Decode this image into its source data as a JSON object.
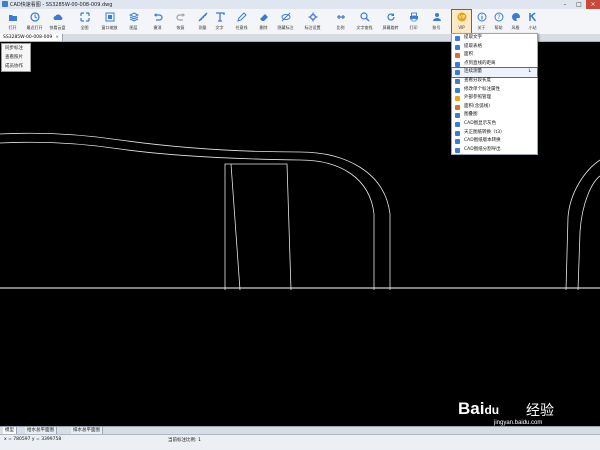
{
  "window": {
    "title": "CAD快速看图 - SS3285W-00-008-009.dwg"
  },
  "toolbar": {
    "items": [
      {
        "label": "打开",
        "icon": "folder-icon",
        "color": "#3a7bd5"
      },
      {
        "label": "最近打开",
        "icon": "clock-icon",
        "color": "#3a7bd5"
      },
      {
        "label": "快看云盘",
        "icon": "cloud-icon",
        "color": "#3a7bd5"
      },
      {
        "label": "全图",
        "icon": "expand-icon",
        "color": "#3a7bd5"
      },
      {
        "label": "窗口缩放",
        "icon": "window-zoom-icon",
        "color": "#3a7bd5"
      },
      {
        "label": "图层",
        "icon": "layers-icon",
        "color": "#3a7bd5"
      },
      {
        "label": "撤消",
        "icon": "undo-icon",
        "color": "#3a7bd5"
      },
      {
        "label": "恢复",
        "icon": "redo-icon",
        "color": "#9aa4b2"
      },
      {
        "label": "测量",
        "icon": "measure-icon",
        "color": "#3a7bd5"
      },
      {
        "label": "文字",
        "icon": "text-icon",
        "color": "#3a7bd5"
      },
      {
        "label": "任意线",
        "icon": "pen-icon",
        "color": "#3a7bd5"
      },
      {
        "label": "删除",
        "icon": "eraser-icon",
        "color": "#3a7bd5"
      },
      {
        "label": "隐藏标注",
        "icon": "eye-off-icon",
        "color": "#3a7bd5"
      },
      {
        "label": "标注设置",
        "icon": "settings-icon",
        "color": "#3a7bd5"
      },
      {
        "label": "比例",
        "icon": "scale-icon",
        "color": "#3a7bd5"
      },
      {
        "label": "文字查找",
        "icon": "search-icon",
        "color": "#3a7bd5"
      },
      {
        "label": "屏幕旋转",
        "icon": "rotate-icon",
        "color": "#3a7bd5"
      },
      {
        "label": "打印",
        "icon": "printer-icon",
        "color": "#3a7bd5"
      },
      {
        "label": "账号",
        "icon": "user-icon",
        "color": "#3a7bd5"
      },
      {
        "label": "VIP",
        "icon": "vip-icon",
        "color": "#e8a317"
      },
      {
        "label": "关于",
        "icon": "info-icon",
        "color": "#3a7bd5"
      },
      {
        "label": "帮助",
        "icon": "help-icon",
        "color": "#3a7bd5"
      },
      {
        "label": "风格",
        "icon": "palette-icon",
        "color": "#3a7bd5"
      },
      {
        "label": "小站",
        "icon": "k-icon",
        "color": "#3a7bd5"
      }
    ]
  },
  "document_tab": {
    "label": "SS3285W-00-008-009",
    "close": "×"
  },
  "left_panel": {
    "items": [
      "同步标注",
      "查看照片",
      "成员协作"
    ]
  },
  "vip_menu": {
    "items": [
      {
        "label": "提取文字",
        "color": "#3a7bd5",
        "shortcut": ""
      },
      {
        "label": "提取表格",
        "color": "#3a7bd5",
        "shortcut": ""
      },
      {
        "label": "面积",
        "color": "#e06c2b",
        "shortcut": ""
      },
      {
        "label": "点到直线的距离",
        "color": "#3a7bd5",
        "shortcut": ""
      },
      {
        "label": "连续测量",
        "color": "#3a7bd5",
        "shortcut": "L"
      },
      {
        "label": "查看分段长度",
        "color": "#3a7bd5",
        "shortcut": ""
      },
      {
        "label": "修改单个标注属性",
        "color": "#3a7bd5",
        "shortcut": ""
      },
      {
        "label": "外部参照管理",
        "color": "#e8a317",
        "shortcut": ""
      },
      {
        "label": "面积(含弧线)",
        "color": "#e06c2b",
        "shortcut": ""
      },
      {
        "label": "图叠图",
        "color": "#3a7bd5",
        "shortcut": ""
      },
      {
        "label": "CAD图显示灰色",
        "color": "#3a7bd5",
        "shortcut": ""
      },
      {
        "label": "天正图纸转换（t3）",
        "color": "#3a7bd5",
        "shortcut": ""
      },
      {
        "label": "CAD图纸版本转换",
        "color": "#3a7bd5",
        "shortcut": ""
      },
      {
        "label": "CAD图纸分割导出",
        "color": "#3a7bd5",
        "shortcut": ""
      }
    ]
  },
  "layout_tabs": [
    "模型",
    "给水总平面图",
    "排水总平面图"
  ],
  "status": {
    "coords": "x = 780597  y = 3399758",
    "scale": "当前标注比例: 1"
  },
  "watermark": {
    "brand": "Bai",
    "paw": "du",
    "suffix": "经验",
    "url": "jingyan.baidu.com"
  }
}
